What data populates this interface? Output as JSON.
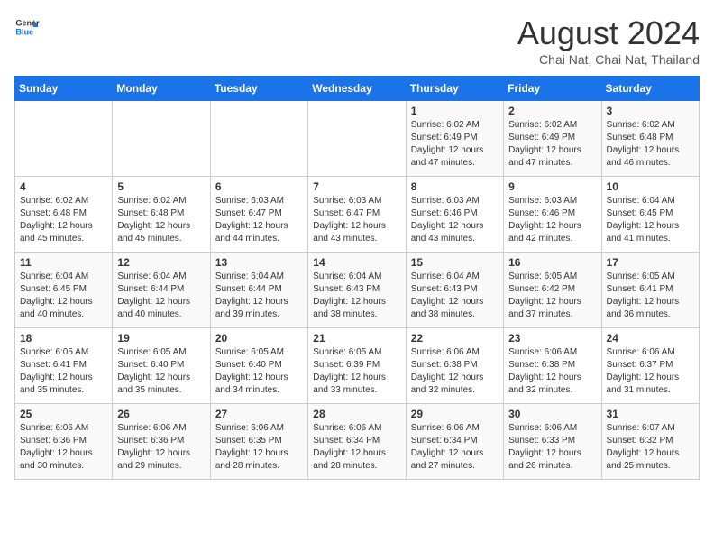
{
  "header": {
    "logo_line1": "General",
    "logo_line2": "Blue",
    "title": "August 2024",
    "subtitle": "Chai Nat, Chai Nat, Thailand"
  },
  "weekdays": [
    "Sunday",
    "Monday",
    "Tuesday",
    "Wednesday",
    "Thursday",
    "Friday",
    "Saturday"
  ],
  "weeks": [
    [
      {
        "day": "",
        "info": ""
      },
      {
        "day": "",
        "info": ""
      },
      {
        "day": "",
        "info": ""
      },
      {
        "day": "",
        "info": ""
      },
      {
        "day": "1",
        "info": "Sunrise: 6:02 AM\nSunset: 6:49 PM\nDaylight: 12 hours\nand 47 minutes."
      },
      {
        "day": "2",
        "info": "Sunrise: 6:02 AM\nSunset: 6:49 PM\nDaylight: 12 hours\nand 47 minutes."
      },
      {
        "day": "3",
        "info": "Sunrise: 6:02 AM\nSunset: 6:48 PM\nDaylight: 12 hours\nand 46 minutes."
      }
    ],
    [
      {
        "day": "4",
        "info": "Sunrise: 6:02 AM\nSunset: 6:48 PM\nDaylight: 12 hours\nand 45 minutes."
      },
      {
        "day": "5",
        "info": "Sunrise: 6:02 AM\nSunset: 6:48 PM\nDaylight: 12 hours\nand 45 minutes."
      },
      {
        "day": "6",
        "info": "Sunrise: 6:03 AM\nSunset: 6:47 PM\nDaylight: 12 hours\nand 44 minutes."
      },
      {
        "day": "7",
        "info": "Sunrise: 6:03 AM\nSunset: 6:47 PM\nDaylight: 12 hours\nand 43 minutes."
      },
      {
        "day": "8",
        "info": "Sunrise: 6:03 AM\nSunset: 6:46 PM\nDaylight: 12 hours\nand 43 minutes."
      },
      {
        "day": "9",
        "info": "Sunrise: 6:03 AM\nSunset: 6:46 PM\nDaylight: 12 hours\nand 42 minutes."
      },
      {
        "day": "10",
        "info": "Sunrise: 6:04 AM\nSunset: 6:45 PM\nDaylight: 12 hours\nand 41 minutes."
      }
    ],
    [
      {
        "day": "11",
        "info": "Sunrise: 6:04 AM\nSunset: 6:45 PM\nDaylight: 12 hours\nand 40 minutes."
      },
      {
        "day": "12",
        "info": "Sunrise: 6:04 AM\nSunset: 6:44 PM\nDaylight: 12 hours\nand 40 minutes."
      },
      {
        "day": "13",
        "info": "Sunrise: 6:04 AM\nSunset: 6:44 PM\nDaylight: 12 hours\nand 39 minutes."
      },
      {
        "day": "14",
        "info": "Sunrise: 6:04 AM\nSunset: 6:43 PM\nDaylight: 12 hours\nand 38 minutes."
      },
      {
        "day": "15",
        "info": "Sunrise: 6:04 AM\nSunset: 6:43 PM\nDaylight: 12 hours\nand 38 minutes."
      },
      {
        "day": "16",
        "info": "Sunrise: 6:05 AM\nSunset: 6:42 PM\nDaylight: 12 hours\nand 37 minutes."
      },
      {
        "day": "17",
        "info": "Sunrise: 6:05 AM\nSunset: 6:41 PM\nDaylight: 12 hours\nand 36 minutes."
      }
    ],
    [
      {
        "day": "18",
        "info": "Sunrise: 6:05 AM\nSunset: 6:41 PM\nDaylight: 12 hours\nand 35 minutes."
      },
      {
        "day": "19",
        "info": "Sunrise: 6:05 AM\nSunset: 6:40 PM\nDaylight: 12 hours\nand 35 minutes."
      },
      {
        "day": "20",
        "info": "Sunrise: 6:05 AM\nSunset: 6:40 PM\nDaylight: 12 hours\nand 34 minutes."
      },
      {
        "day": "21",
        "info": "Sunrise: 6:05 AM\nSunset: 6:39 PM\nDaylight: 12 hours\nand 33 minutes."
      },
      {
        "day": "22",
        "info": "Sunrise: 6:06 AM\nSunset: 6:38 PM\nDaylight: 12 hours\nand 32 minutes."
      },
      {
        "day": "23",
        "info": "Sunrise: 6:06 AM\nSunset: 6:38 PM\nDaylight: 12 hours\nand 32 minutes."
      },
      {
        "day": "24",
        "info": "Sunrise: 6:06 AM\nSunset: 6:37 PM\nDaylight: 12 hours\nand 31 minutes."
      }
    ],
    [
      {
        "day": "25",
        "info": "Sunrise: 6:06 AM\nSunset: 6:36 PM\nDaylight: 12 hours\nand 30 minutes."
      },
      {
        "day": "26",
        "info": "Sunrise: 6:06 AM\nSunset: 6:36 PM\nDaylight: 12 hours\nand 29 minutes."
      },
      {
        "day": "27",
        "info": "Sunrise: 6:06 AM\nSunset: 6:35 PM\nDaylight: 12 hours\nand 28 minutes."
      },
      {
        "day": "28",
        "info": "Sunrise: 6:06 AM\nSunset: 6:34 PM\nDaylight: 12 hours\nand 28 minutes."
      },
      {
        "day": "29",
        "info": "Sunrise: 6:06 AM\nSunset: 6:34 PM\nDaylight: 12 hours\nand 27 minutes."
      },
      {
        "day": "30",
        "info": "Sunrise: 6:06 AM\nSunset: 6:33 PM\nDaylight: 12 hours\nand 26 minutes."
      },
      {
        "day": "31",
        "info": "Sunrise: 6:07 AM\nSunset: 6:32 PM\nDaylight: 12 hours\nand 25 minutes."
      }
    ]
  ]
}
